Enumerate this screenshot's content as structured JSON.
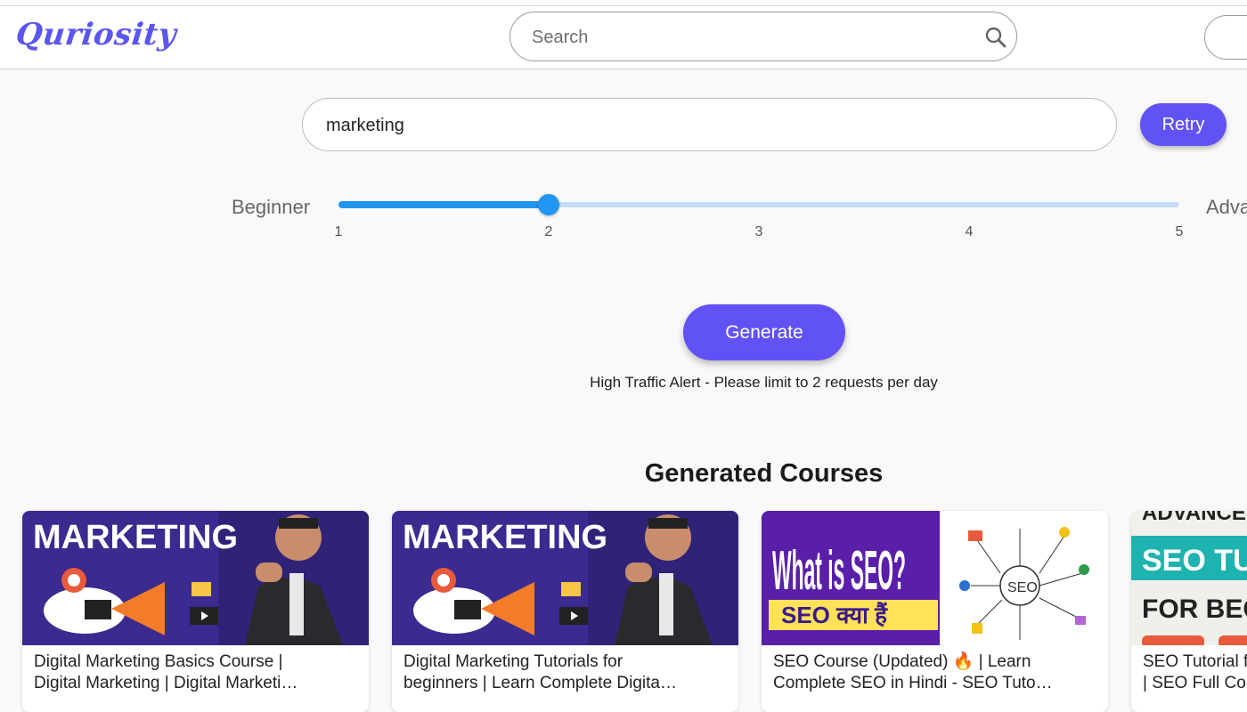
{
  "header": {
    "logo": "Quriosity",
    "search_placeholder": "Search"
  },
  "topic": {
    "value": "marketing",
    "retry_label": "Retry"
  },
  "level": {
    "left_label": "Beginner",
    "right_label": "Adva",
    "ticks": [
      "1",
      "2",
      "3",
      "4",
      "5"
    ],
    "value": 2,
    "min": 1,
    "max": 5
  },
  "generate": {
    "label": "Generate",
    "alert": "High Traffic Alert - Please limit to 2 requests per day"
  },
  "courses": {
    "heading": "Generated Courses",
    "items": [
      {
        "thumb_text": "MARKETING",
        "title_line1": "Digital Marketing Basics Course |",
        "title_line2": "Digital Marketing | Digital Marketi…"
      },
      {
        "thumb_text": "MARKETING",
        "title_line1": "Digital Marketing Tutorials for",
        "title_line2": "beginners | Learn Complete Digita…"
      },
      {
        "thumb_text": "What is SEO?",
        "thumb_sub": "SEO क्या हैं",
        "title_line1": "SEO Course (Updated) 🔥 | Learn",
        "title_line2": "Complete SEO in Hindi - SEO Tuto…"
      },
      {
        "thumb_text": "ADVANCE",
        "thumb_sub": "SEO TU",
        "thumb_sub2": "FOR BEGI",
        "title_line1": "SEO Tutorial f",
        "title_line2": "| SEO Full Cou"
      }
    ]
  },
  "colors": {
    "accent": "#6152f5",
    "slider": "#2196f3",
    "logo": "#5b55f0"
  }
}
